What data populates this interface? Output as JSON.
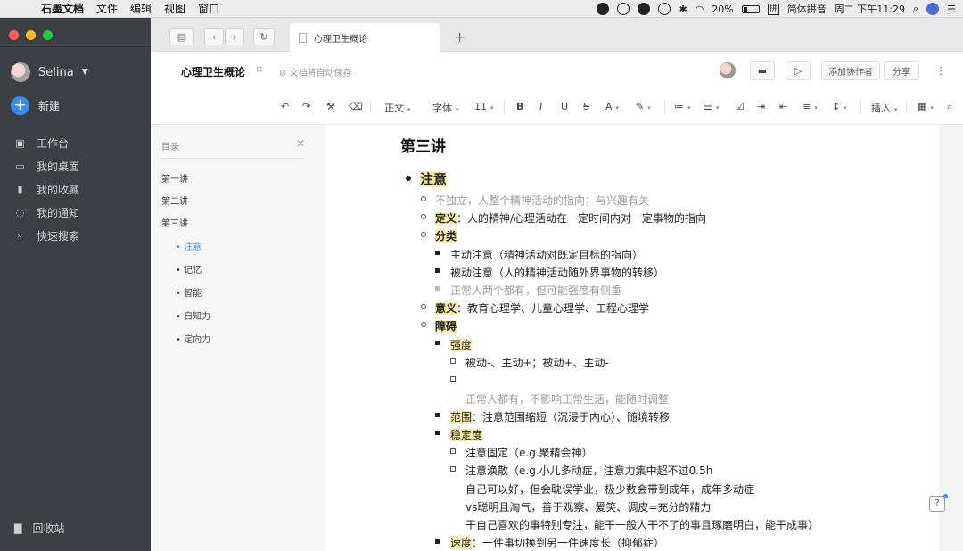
{
  "menubar": {
    "app": "石墨文档",
    "items": [
      "文件",
      "编辑",
      "视图",
      "窗口"
    ],
    "battery": "20%",
    "ime": "简体拼音",
    "ime_glyph": "拼",
    "clock": "周二 下午11:29"
  },
  "sidebar": {
    "user": "Selina",
    "new_label": "新建",
    "nav": [
      {
        "label": "工作台",
        "icon": "workbench-icon"
      },
      {
        "label": "我的桌面",
        "icon": "desktop-icon"
      },
      {
        "label": "我的收藏",
        "icon": "bookmark-icon"
      },
      {
        "label": "我的通知",
        "icon": "bell-icon"
      },
      {
        "label": "快速搜索",
        "icon": "search-icon"
      }
    ],
    "trash": "回收站"
  },
  "tab": {
    "title": "心理卫生概论"
  },
  "header": {
    "title": "心理卫生概论",
    "autosave": "文档将自动保存",
    "add_collaborator": "添加协作者",
    "share": "分享"
  },
  "toolbar": {
    "style": "正文",
    "font": "字体",
    "size": "11",
    "bold": "B",
    "italic": "I",
    "underline": "U",
    "strike": "S",
    "font_color": "A",
    "insert": "插入"
  },
  "toc": {
    "title": "目录",
    "items": [
      "第一讲",
      "第二讲",
      "第三讲"
    ],
    "sub": [
      "注意",
      "记忆",
      "智能",
      "自知力",
      "定向力"
    ],
    "active": "注意"
  },
  "doc": {
    "heading": "第三讲",
    "l1": "注意",
    "l2": "不独立，人整个精神活动的指向；与兴趣有关",
    "l3_key": "定义",
    "l3_val": "：人的精神/心理活动在一定时间内对一定事物的指向",
    "l4": "分类",
    "l5": "主动注意（精神活动对既定目标的指向）",
    "l6": "被动注意（人的精神活动随外界事物的转移）",
    "l7": "正常人两个都有，但可能强度有侧重",
    "l8_key": "意义",
    "l8_val": "：教育心理学、儿童心理学、工程心理学",
    "l9": "障碍",
    "l10": "强度",
    "l11": "被动-、主动+；被动+、主动-",
    "l12": "正常人都有，不影响正常生活，能随时调整",
    "l13_key": "范围",
    "l13_val": "：注意范围缩短（沉浸于内心）、随境转移",
    "l14": "稳定度",
    "l15": "注意固定（e.g.聚精会神）",
    "l16": "注意涣散（e.g.小儿多动症，注意力集中超不过0.5h",
    "l17": "自己可以好，但会耽误学业，极少数会带到成年，成年多动症",
    "l18": "vs聪明且淘气，善于观察、爱笑、调皮=充分的精力",
    "l19": "干自己喜欢的事特别专注，能干一般人干不了的事且琢磨明白，能干成事）",
    "l20_key": "速度",
    "l20_val": "：一件事切换到另一件速度长（抑郁症）"
  }
}
